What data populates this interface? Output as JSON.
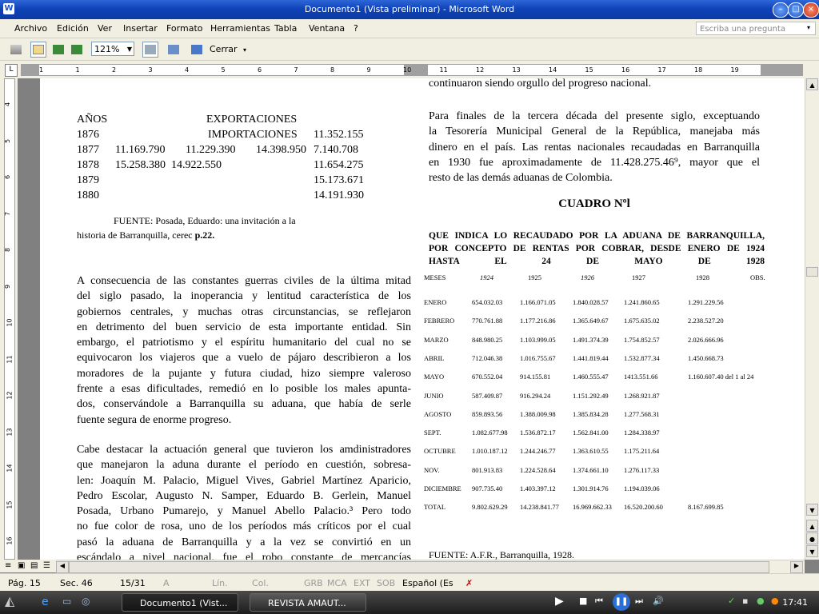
{
  "window": {
    "title": "Documento1 (Vista preliminar) - Microsoft Word",
    "app_icon": "W"
  },
  "menu": {
    "items": [
      "Archivo",
      "Edición",
      "Ver",
      "Insertar",
      "Formato",
      "Herramientas",
      "Tabla",
      "Ventana",
      "?"
    ],
    "ask_placeholder": "Escriba una pregunta"
  },
  "toolbar": {
    "zoom": "121%",
    "close_label": "Cerrar"
  },
  "ruler": {
    "h_numbers": [
      "1",
      "1",
      "2",
      "3",
      "4",
      "5",
      "6",
      "7",
      "8",
      "9",
      "10",
      "11",
      "12",
      "13",
      "14",
      "15",
      "16",
      "17",
      "18",
      "19"
    ],
    "v_numbers": [
      "4",
      "5",
      "6",
      "7",
      "8",
      "9",
      "10",
      "11",
      "12",
      "13",
      "14",
      "15",
      "16"
    ]
  },
  "doc": {
    "left": {
      "table_header": {
        "years": "AÑOS",
        "exp": "EXPORTACIONES",
        "imp": "IMPORTACIONES"
      },
      "rows": [
        {
          "year": "1876",
          "a": "",
          "b": "",
          "c": "",
          "d": "11.352.155"
        },
        {
          "year": "1877",
          "a": "11.169.790",
          "b": "11.229.390",
          "c": "14.398.950",
          "d": "7.140.708"
        },
        {
          "year": "1878",
          "a": "15.258.380",
          "b": "14.922.550",
          "c": "",
          "d": "11.654.275"
        },
        {
          "year": "1879",
          "a": "",
          "b": "",
          "c": "",
          "d": "15.173.671"
        },
        {
          "year": "1880",
          "a": "",
          "b": "",
          "c": "",
          "d": "14.191.930"
        }
      ],
      "fuente1": "FUENTE: Posada, Eduardo: una invitación a la",
      "fuente2": "historia de Barranquilla, cerec",
      "fuente2b": "p.22.",
      "p1": [
        "A consecuencia de las constantes guerras civiles de la última mitad",
        "del siglo pasado, la inoperancia y lentitud característica de los",
        "gobiernos centrales, y muchas otras circunstancias, se reflejaron",
        "en detrimento del buen servicio de esta importante entidad. Sin",
        "embargo, el patriotismo y el espíritu humanitario del cual no se",
        "equivocaron los viajeros que a vuelo de pájaro describieron a los",
        "moradores de la pujante y futura ciudad, hizo siempre valeroso",
        "frente a esas dificultades, remedió en lo posible los males apunta-",
        "dos, conservándole a Barranquilla su aduana, que había de serle",
        "fuente segura de enorme progreso."
      ],
      "p2": [
        "Cabe destacar la actuación general que tuvieron los amdinistradores",
        "que manejaron la aduna durante el período en cuestión, sobresa-",
        "len: Joaquín M. Palacio, Miguel Vives, Gabriel Martínez Aparicio,",
        "Pedro Escolar, Augusto N. Samper, Eduardo B. Gerlein, Manuel",
        "Posada, Urbano Pumarejo, y Manuel Abello Palacio.³ Pero todo",
        "no fue color de rosa, uno de los períodos más críticos por el cual",
        "pasó la aduana de Barranquilla y a la vez se convirtió en un",
        "escándalo a nivel nacional, fue el robo constante de mercancías"
      ]
    },
    "right": {
      "top_line": "continuaron siendo orgullo del progreso nacional.",
      "p1": [
        "Para finales de la tercera década del presente siglo, exceptuando",
        "la Tesorería Municipal General de la República, manejaba más",
        "dinero en el país. Las rentas nacionales recaudadas en Barranquilla",
        "en 1930 fue aproximadamente de 11.428.275.46⁹, mayor que el",
        "resto de las demás aduanas de Colombia."
      ],
      "cuadro_title": "CUADRO Nºl",
      "cuadro_sub": [
        "QUE INDICA LO RECAUDADO POR LA ADUANA DE BARRANQUILLA,",
        "POR CONCEPTO DE RENTAS POR COBRAR, DESDE ENERO DE 1924",
        "HASTA EL 24 DE MAYO DE 1928"
      ],
      "headers": [
        "MESES",
        "1924",
        "1925",
        "1926",
        "1927",
        "1928",
        "OBS."
      ],
      "rows": [
        [
          "ENERO",
          "654.032.03",
          "1.166.071.05",
          "1.840.028.57",
          "1.241.860.65",
          "1.291.229.56",
          ""
        ],
        [
          "FEBRERO",
          "770.761.88",
          "1.177.216.86",
          "1.365.649.67",
          "1.675.635.02",
          "2.238.527.20",
          ""
        ],
        [
          "MARZO",
          "848.980.25",
          "1.103.999.05",
          "1.491.374.39",
          "1.754.852.57",
          "2.026.666.96",
          ""
        ],
        [
          "ABRIL",
          "712.046.38",
          "1.016.755.67",
          "1.441.819.44",
          "1.532.877.34",
          "1.450.668.73",
          ""
        ],
        [
          "MAYO",
          "670.552.04",
          "914.155.81",
          "1.460.555.47",
          "1413.551.66",
          "1.160.607.40 del 1 al 24",
          ""
        ],
        [
          "JUNIO",
          "587.409.87",
          "916.294.24",
          "1.151.292.49",
          "1.268.921.87",
          "",
          ""
        ],
        [
          "AGOSTO",
          "859.893.56",
          "1.388.009.98",
          "1.385.834.28",
          "1.277.568.31",
          "",
          ""
        ],
        [
          "SEPT.",
          "1.082.677.98",
          "1.536.872.17",
          "1.562.841.00",
          "1.284.338.97",
          "",
          ""
        ],
        [
          "OCTUBRE",
          "1.010.187.12",
          "1.244.246.77",
          "1.363.610.55",
          "1.175.211.64",
          "",
          ""
        ],
        [
          "NOV.",
          "801.913.83",
          "1.224.528.64",
          "1.374.661.10",
          "1.276.117.33",
          "",
          ""
        ],
        [
          "DICIEMBRE",
          "907.735.40",
          "1.403.397.12",
          "1.301.914.76",
          "1.194.039.06",
          "",
          ""
        ],
        [
          "TOTAL",
          "9.802.629.29",
          "14.238.841.77",
          "16.969.662.33",
          "16.520.200.60",
          "8.167.699.85",
          ""
        ]
      ],
      "fuente": "FUENTE: A.F.R., Barranquilla, 1928."
    }
  },
  "status": {
    "page": "Pág. 15",
    "sec": "Sec. 46",
    "pos": "15/31",
    "at": "A",
    "lin": "Lín.",
    "col": "Col.",
    "grb": "GRB",
    "mca": "MCA",
    "ext": "EXT",
    "sob": "SOB",
    "lang": "Español (Es"
  },
  "taskbar": {
    "btn1": "Documento1 (Vist...",
    "btn2": "REVISTA AMAUT...",
    "clock": "17:41"
  }
}
